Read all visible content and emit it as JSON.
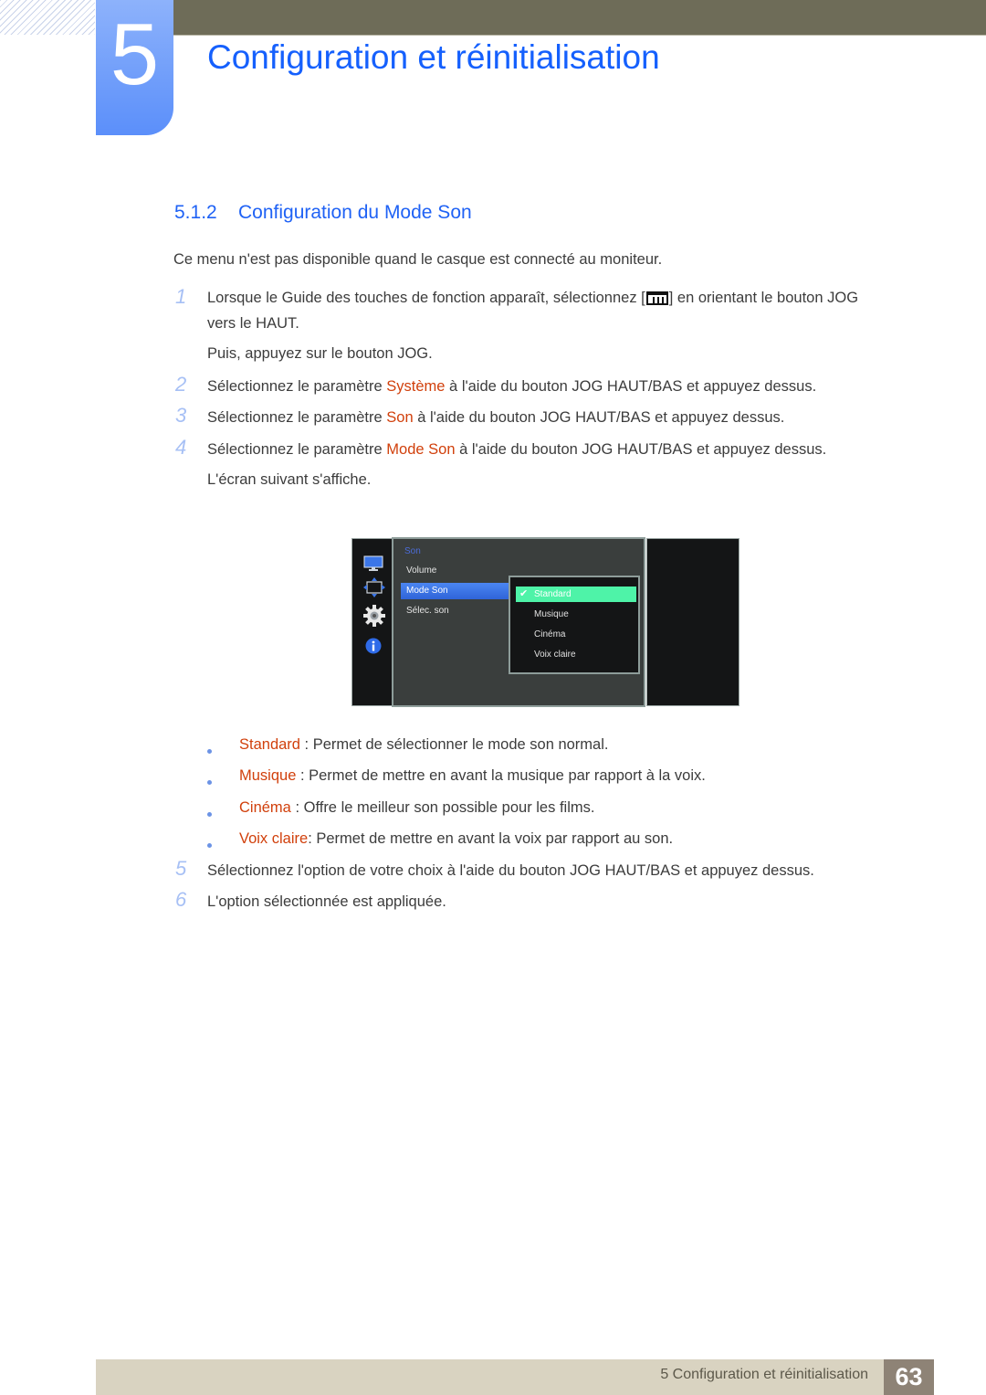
{
  "chapter": {
    "number": "5",
    "title": "Configuration et réinitialisation"
  },
  "section": {
    "number": "5.1.2",
    "title": "Configuration du Mode Son"
  },
  "intro": "Ce menu n'est pas disponible quand le casque est connecté au moniteur.",
  "steps": [
    {
      "num": "1",
      "line1_before": "Lorsque le Guide des touches de fonction apparaît, sélectionnez [",
      "icon": "menu-icon",
      "line1_after": "] en orientant le bouton JOG",
      "line2": "vers le HAUT.",
      "line3": "Puis, appuyez sur le bouton JOG."
    },
    {
      "num": "2",
      "before": "Sélectionnez le paramètre ",
      "highlight": "Système",
      "after": " à l'aide du bouton JOG HAUT/BAS et appuyez dessus."
    },
    {
      "num": "3",
      "before": "Sélectionnez le paramètre ",
      "highlight": "Son",
      "after": " à l'aide du bouton JOG HAUT/BAS et appuyez dessus."
    },
    {
      "num": "4",
      "before": "Sélectionnez le paramètre ",
      "highlight": "Mode Son",
      "after": " à l'aide du bouton JOG HAUT/BAS et appuyez dessus.",
      "line2": "L'écran suivant s'affiche."
    },
    {
      "num": "5",
      "text": "Sélectionnez l'option de votre choix à l'aide du bouton JOG HAUT/BAS et appuyez dessus."
    },
    {
      "num": "6",
      "text": "L'option sélectionnée est appliquée."
    }
  ],
  "osd": {
    "side_icons": [
      "monitor-icon",
      "resize-arrows-icon",
      "gear-icon",
      "info-icon"
    ],
    "heading": "Son",
    "items": [
      "Volume",
      "Mode Son",
      "Sélec. son"
    ],
    "active_item": "Mode Son",
    "options": [
      "Standard",
      "Musique",
      "Cinéma",
      "Voix claire"
    ],
    "selected_option": "Standard",
    "colors": {
      "heading": "#4b6cd8",
      "active_item": "#3a72e6",
      "selected_option": "#4ef3a8"
    }
  },
  "bullets": [
    {
      "term": "Standard",
      "desc": " : Permet de sélectionner le mode son normal."
    },
    {
      "term": "Musique",
      "desc": " : Permet de mettre en avant la musique par rapport à la voix."
    },
    {
      "term": "Cinéma",
      "desc": " : Offre le meilleur son possible pour les films."
    },
    {
      "term": "Voix claire",
      "desc": ": Permet de mettre en avant la voix par rapport au son."
    }
  ],
  "footer": {
    "text": "5 Configuration et réinitialisation",
    "page": "63"
  },
  "colors": {
    "title_blue": "#1560fd",
    "highlight_orange": "#d1400c",
    "step_number": "#a7c0f5",
    "top_bar": "#6e6c58",
    "footer_bg": "#d9d3c1",
    "page_badge": "#8e8376"
  }
}
